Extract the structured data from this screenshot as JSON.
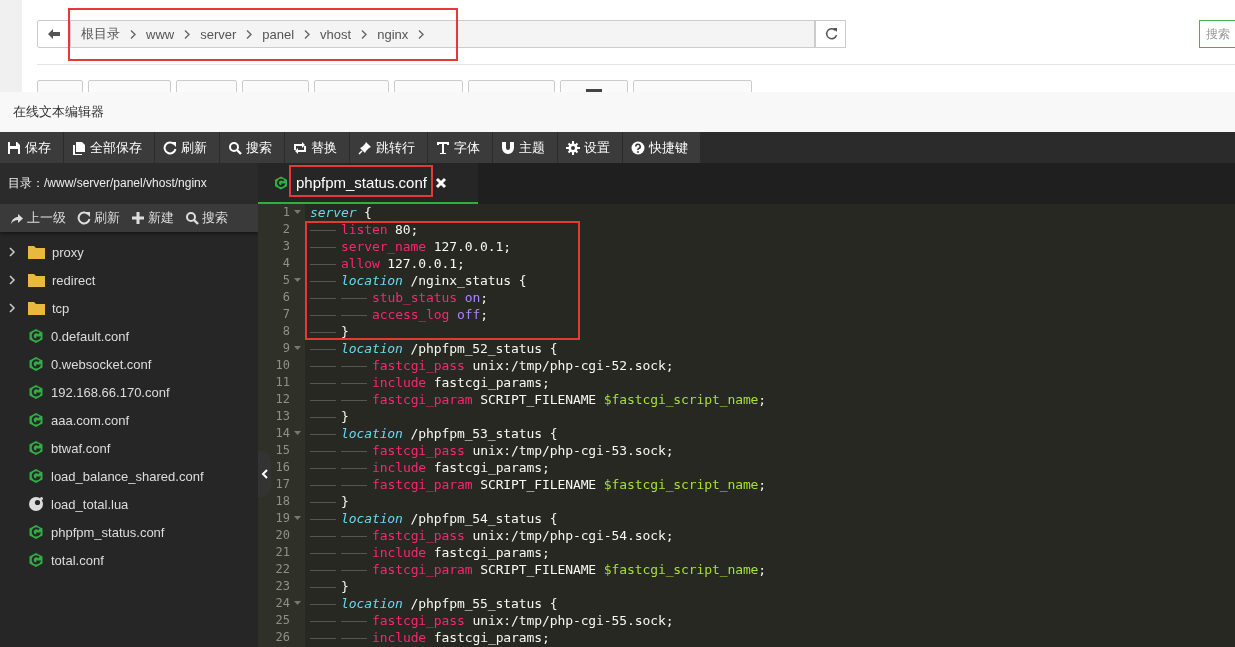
{
  "background_page": {
    "breadcrumb": {
      "highlighted": true,
      "items": [
        "根目录",
        "www",
        "server",
        "panel",
        "vhost",
        "nginx"
      ]
    },
    "search": {
      "placeholder": "搜索"
    },
    "buttons": [
      {
        "kind": "plain"
      },
      {
        "kind": "plain"
      },
      {
        "kind": "plain"
      },
      {
        "kind": "plain"
      },
      {
        "kind": "plain"
      },
      {
        "kind": "plain"
      },
      {
        "kind": "plain"
      },
      {
        "kind": "icon"
      },
      {
        "kind": "plain"
      }
    ]
  },
  "window": {
    "title": "在线文本编辑器"
  },
  "toolbar": [
    {
      "kind": "save",
      "label": "保存"
    },
    {
      "kind": "copy",
      "label": "全部保存"
    },
    {
      "kind": "refresh",
      "label": "刷新"
    },
    {
      "kind": "search",
      "label": "搜索"
    },
    {
      "kind": "replace",
      "label": "替换"
    },
    {
      "kind": "pin",
      "label": "跳转行"
    },
    {
      "kind": "font",
      "label": "字体"
    },
    {
      "kind": "magnet",
      "label": "主题"
    },
    {
      "kind": "settings",
      "label": "设置"
    },
    {
      "kind": "help",
      "label": "快捷键"
    }
  ],
  "sidebar": {
    "path": "目录：/www/server/panel/vhost/nginx",
    "actions": [
      {
        "kind": "up",
        "label": "上一级"
      },
      {
        "kind": "refresh",
        "label": "刷新"
      },
      {
        "kind": "new",
        "label": "新建"
      },
      {
        "kind": "search",
        "label": "搜索"
      }
    ],
    "items": [
      {
        "kind": "folder",
        "name": "proxy",
        "expanded": false
      },
      {
        "kind": "folder",
        "name": "redirect",
        "expanded": false
      },
      {
        "kind": "folder",
        "name": "tcp",
        "expanded": false
      },
      {
        "kind": "conf",
        "name": "0.default.conf"
      },
      {
        "kind": "conf",
        "name": "0.websocket.conf"
      },
      {
        "kind": "conf",
        "name": "192.168.66.170.conf"
      },
      {
        "kind": "conf",
        "name": "aaa.com.conf"
      },
      {
        "kind": "conf",
        "name": "btwaf.conf"
      },
      {
        "kind": "conf",
        "name": "load_balance_shared.conf"
      },
      {
        "kind": "lua",
        "name": "load_total.lua"
      },
      {
        "kind": "conf",
        "name": "phpfpm_status.conf"
      },
      {
        "kind": "conf",
        "name": "total.conf"
      }
    ]
  },
  "tabs": [
    {
      "name": "phpfpm_status.conf",
      "selected": true,
      "highlighted": true
    }
  ],
  "code": [
    {
      "number": "1",
      "fold": true,
      "highlighted": false,
      "tokens": [
        {
          "kind": "keyword",
          "text": "server"
        },
        {
          "kind": "plain",
          "text": " {"
        }
      ],
      "children": [
        {
          "number": "2",
          "fold": false,
          "highlighted": true,
          "tokens": [
            {
              "kind": "directive",
              "text": "listen"
            },
            {
              "kind": "plain",
              "text": " 80;"
            }
          ]
        },
        {
          "number": "3",
          "fold": false,
          "highlighted": true,
          "tokens": [
            {
              "kind": "directive",
              "text": "server_name"
            },
            {
              "kind": "plain",
              "text": " 127.0.0.1;"
            }
          ]
        },
        {
          "number": "4",
          "fold": false,
          "highlighted": true,
          "tokens": [
            {
              "kind": "directive",
              "text": "allow"
            },
            {
              "kind": "plain",
              "text": " 127.0.0.1;"
            }
          ]
        },
        {
          "number": "5",
          "fold": true,
          "highlighted": true,
          "tokens": [
            {
              "kind": "keyword",
              "text": "location"
            },
            {
              "kind": "plain",
              "text": " /nginx_status {"
            }
          ],
          "children": [
            {
              "number": "6",
              "fold": false,
              "highlighted": true,
              "tokens": [
                {
                  "kind": "directive",
                  "text": "stub_status "
                },
                {
                  "kind": "value",
                  "text": "on"
                },
                {
                  "kind": "plain",
                  "text": ";"
                }
              ]
            },
            {
              "number": "7",
              "fold": false,
              "highlighted": true,
              "tokens": [
                {
                  "kind": "directive",
                  "text": "access_log "
                },
                {
                  "kind": "value",
                  "text": "off"
                },
                {
                  "kind": "plain",
                  "text": ";"
                }
              ]
            }
          ]
        },
        {
          "number": "8",
          "fold": false,
          "highlighted": true,
          "tokens": [
            {
              "kind": "plain",
              "text": "}"
            }
          ]
        },
        {
          "number": "9",
          "fold": true,
          "highlighted": false,
          "tokens": [
            {
              "kind": "keyword",
              "text": "location"
            },
            {
              "kind": "plain",
              "text": " /phpfpm_52_status {"
            }
          ],
          "children": [
            {
              "number": "10",
              "fold": false,
              "highlighted": false,
              "tokens": [
                {
                  "kind": "directive",
                  "text": "fastcgi_pass"
                },
                {
                  "kind": "plain",
                  "text": " unix:/tmp/php-cgi-52.sock;"
                }
              ]
            },
            {
              "number": "11",
              "fold": false,
              "highlighted": false,
              "tokens": [
                {
                  "kind": "directive",
                  "text": "include"
                },
                {
                  "kind": "plain",
                  "text": " fastcgi_params;"
                }
              ]
            },
            {
              "number": "12",
              "fold": false,
              "highlighted": false,
              "tokens": [
                {
                  "kind": "directive",
                  "text": "fastcgi_param"
                },
                {
                  "kind": "plain",
                  "text": " SCRIPT_FILENAME "
                },
                {
                  "kind": "variable",
                  "text": "$fastcgi_script_name"
                },
                {
                  "kind": "plain",
                  "text": ";"
                }
              ]
            }
          ]
        },
        {
          "number": "13",
          "fold": false,
          "highlighted": false,
          "tokens": [
            {
              "kind": "plain",
              "text": "}"
            }
          ]
        },
        {
          "number": "14",
          "fold": true,
          "highlighted": false,
          "tokens": [
            {
              "kind": "keyword",
              "text": "location"
            },
            {
              "kind": "plain",
              "text": " /phpfpm_53_status {"
            }
          ],
          "children": [
            {
              "number": "15",
              "fold": false,
              "highlighted": false,
              "tokens": [
                {
                  "kind": "directive",
                  "text": "fastcgi_pass"
                },
                {
                  "kind": "plain",
                  "text": " unix:/tmp/php-cgi-53.sock;"
                }
              ]
            },
            {
              "number": "16",
              "fold": false,
              "highlighted": false,
              "tokens": [
                {
                  "kind": "directive",
                  "text": "include"
                },
                {
                  "kind": "plain",
                  "text": " fastcgi_params;"
                }
              ]
            },
            {
              "number": "17",
              "fold": false,
              "highlighted": false,
              "tokens": [
                {
                  "kind": "directive",
                  "text": "fastcgi_param"
                },
                {
                  "kind": "plain",
                  "text": " SCRIPT_FILENAME "
                },
                {
                  "kind": "variable",
                  "text": "$fastcgi_script_name"
                },
                {
                  "kind": "plain",
                  "text": ";"
                }
              ]
            }
          ]
        },
        {
          "number": "18",
          "fold": false,
          "highlighted": false,
          "tokens": [
            {
              "kind": "plain",
              "text": "}"
            }
          ]
        },
        {
          "number": "19",
          "fold": true,
          "highlighted": false,
          "tokens": [
            {
              "kind": "keyword",
              "text": "location"
            },
            {
              "kind": "plain",
              "text": " /phpfpm_54_status {"
            }
          ],
          "children": [
            {
              "number": "20",
              "fold": false,
              "highlighted": false,
              "tokens": [
                {
                  "kind": "directive",
                  "text": "fastcgi_pass"
                },
                {
                  "kind": "plain",
                  "text": " unix:/tmp/php-cgi-54.sock;"
                }
              ]
            },
            {
              "number": "21",
              "fold": false,
              "highlighted": false,
              "tokens": [
                {
                  "kind": "directive",
                  "text": "include"
                },
                {
                  "kind": "plain",
                  "text": " fastcgi_params;"
                }
              ]
            },
            {
              "number": "22",
              "fold": false,
              "highlighted": false,
              "tokens": [
                {
                  "kind": "directive",
                  "text": "fastcgi_param"
                },
                {
                  "kind": "plain",
                  "text": " SCRIPT_FILENAME "
                },
                {
                  "kind": "variable",
                  "text": "$fastcgi_script_name"
                },
                {
                  "kind": "plain",
                  "text": ";"
                }
              ]
            }
          ]
        },
        {
          "number": "23",
          "fold": false,
          "highlighted": false,
          "tokens": [
            {
              "kind": "plain",
              "text": "}"
            }
          ]
        },
        {
          "number": "24",
          "fold": true,
          "highlighted": false,
          "tokens": [
            {
              "kind": "keyword",
              "text": "location"
            },
            {
              "kind": "plain",
              "text": " /phpfpm_55_status {"
            }
          ],
          "children": [
            {
              "number": "25",
              "fold": false,
              "highlighted": false,
              "tokens": [
                {
                  "kind": "directive",
                  "text": "fastcgi_pass"
                },
                {
                  "kind": "plain",
                  "text": " unix:/tmp/php-cgi-55.sock;"
                }
              ]
            },
            {
              "number": "26",
              "fold": false,
              "highlighted": false,
              "tokens": [
                {
                  "kind": "directive",
                  "text": "include"
                },
                {
                  "kind": "plain",
                  "text": " fastcgi_params;"
                }
              ]
            }
          ]
        }
      ]
    }
  ]
}
